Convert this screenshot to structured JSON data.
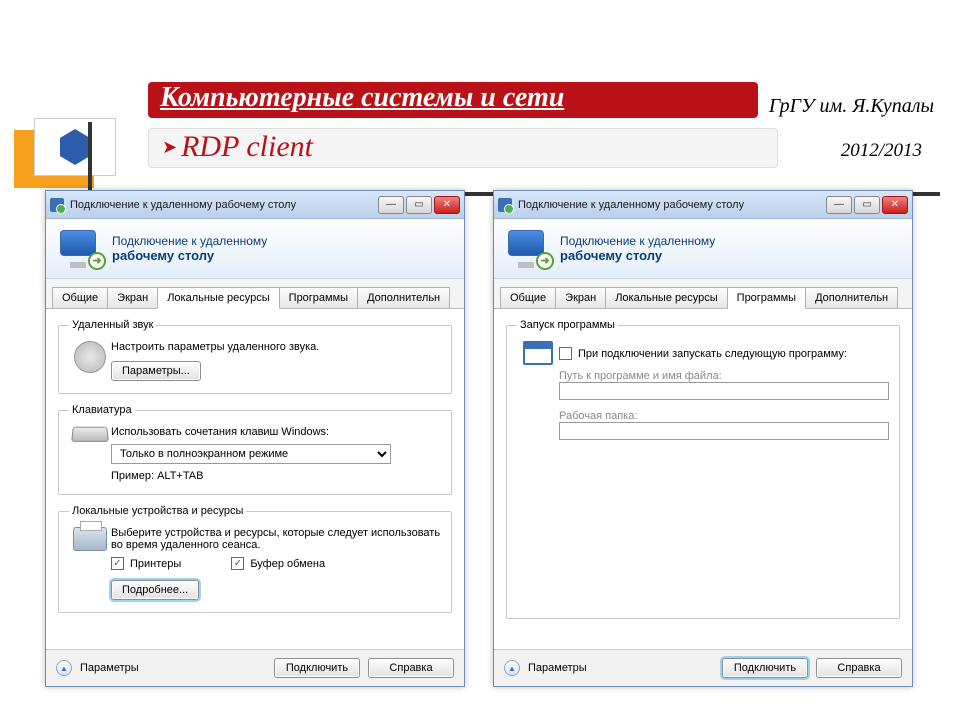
{
  "slide": {
    "title": "Компьютерные системы и сети",
    "subtitle": "RDP client",
    "university": "ГрГУ им. Я.Купалы",
    "year": "2012/2013"
  },
  "dialog": {
    "windowTitle": "Подключение к удаленному рабочему столу",
    "bannerLine1": "Подключение к удаленному",
    "bannerLine2": "рабочему столу",
    "tabs": {
      "general": "Общие",
      "display": "Экран",
      "local": "Локальные ресурсы",
      "programs": "Программы",
      "advanced": "Дополнительн"
    },
    "footer": {
      "options": "Параметры",
      "connect": "Подключить",
      "help": "Справка"
    }
  },
  "local": {
    "audio": {
      "legend": "Удаленный звук",
      "desc": "Настроить параметры удаленного звука.",
      "btn": "Параметры..."
    },
    "keyboard": {
      "legend": "Клавиатура",
      "desc": "Использовать сочетания клавиш Windows:",
      "combo": "Только в полноэкранном режиме",
      "example": "Пример: ALT+TAB"
    },
    "devices": {
      "legend": "Локальные устройства и ресурсы",
      "desc": "Выберите устройства и ресурсы, которые следует использовать во время удаленного сеанса.",
      "printers": "Принтеры",
      "clipboard": "Буфер обмена",
      "more": "Подробнее..."
    }
  },
  "programs": {
    "legend": "Запуск программы",
    "checkbox": "При подключении запускать следующую программу:",
    "pathLabel": "Путь к программе и имя файла:",
    "pathValue": "",
    "folderLabel": "Рабочая папка:",
    "folderValue": ""
  }
}
